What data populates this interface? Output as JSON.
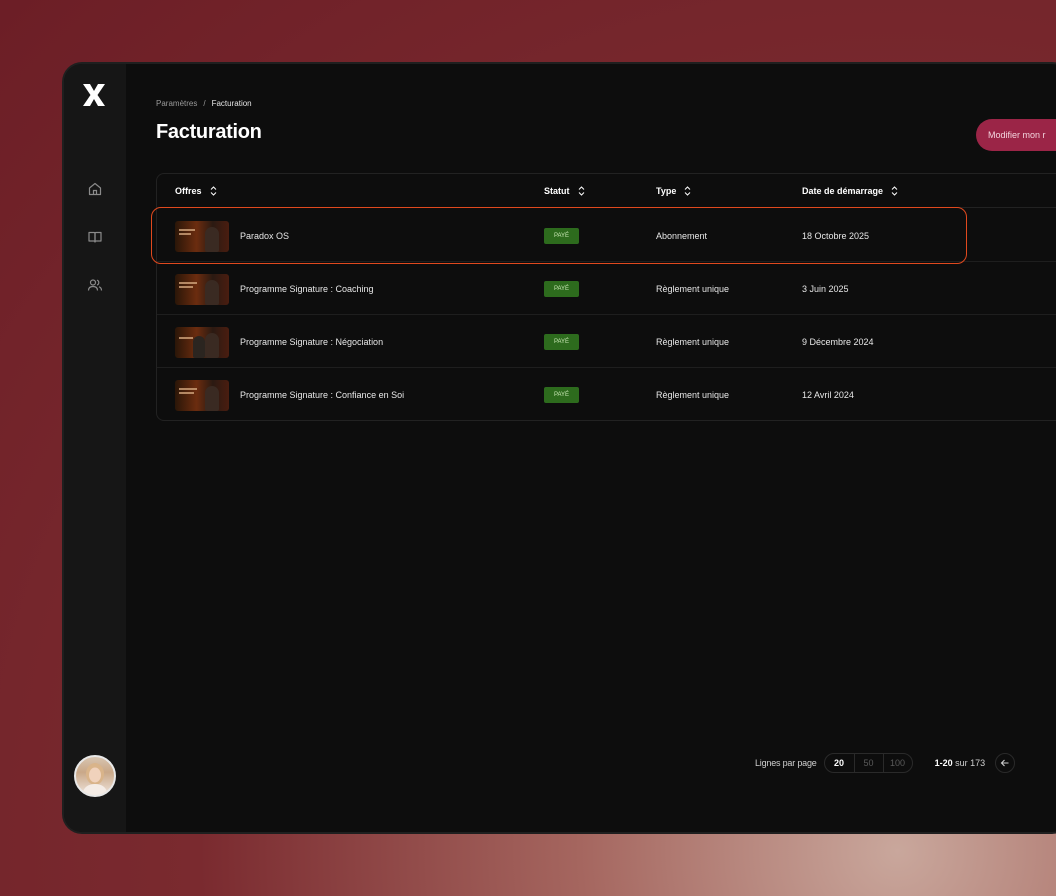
{
  "breadcrumb": {
    "parent": "Paramètres",
    "separator": "/",
    "current": "Facturation"
  },
  "page": {
    "title": "Facturation",
    "action_label": "Modifier mon r"
  },
  "colors": {
    "accent": "#9b2547",
    "paid_badge": "#2d6b1d",
    "highlight_border": "#e0491e"
  },
  "table": {
    "headers": {
      "offer": "Offres",
      "status": "Statut",
      "type": "Type",
      "start_date": "Date de démarrage"
    },
    "rows": [
      {
        "name": "Paradox OS",
        "status": "PAYÉ",
        "type": "Abonnement",
        "date": "18 Octobre 2025"
      },
      {
        "name": "Programme Signature : Coaching",
        "status": "PAYÉ",
        "type": "Règlement unique",
        "date": "3 Juin 2025"
      },
      {
        "name": "Programme Signature : Négociation",
        "status": "PAYÉ",
        "type": "Règlement unique",
        "date": "9 Décembre 2024"
      },
      {
        "name": "Programme Signature : Confiance en Soi",
        "status": "PAYÉ",
        "type": "Règlement unique",
        "date": "12 Avril 2024"
      }
    ]
  },
  "pagination": {
    "rows_per_page_label": "Lignes par page",
    "options": [
      "20",
      "50",
      "100"
    ],
    "range": "1-20",
    "of_total": "sur 173"
  },
  "sidebar": {
    "icons": [
      "home-icon",
      "book-icon",
      "users-icon"
    ]
  }
}
